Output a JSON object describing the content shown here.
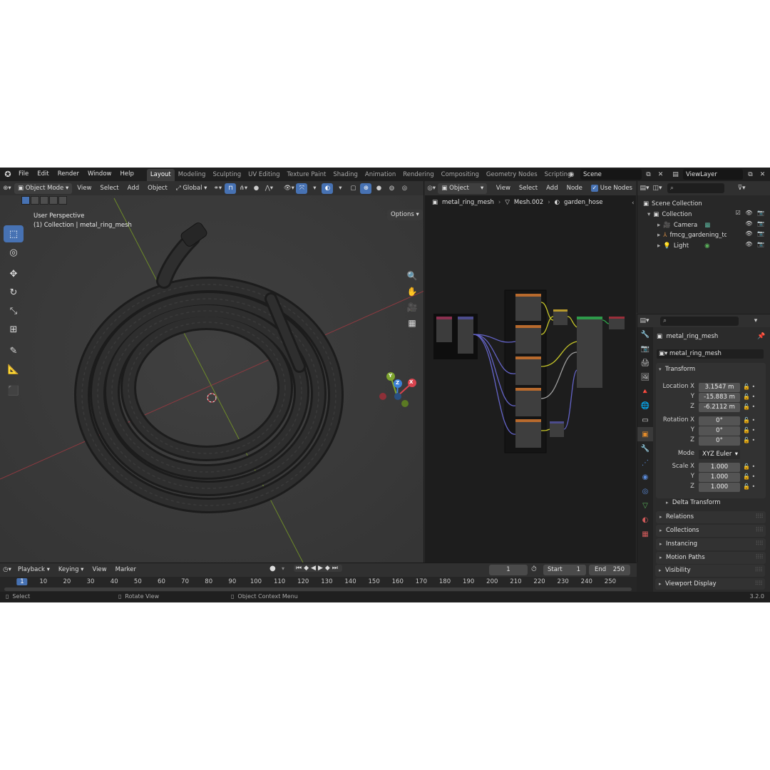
{
  "topbar": {
    "menus": [
      "File",
      "Edit",
      "Render",
      "Window",
      "Help"
    ],
    "workspaces": [
      "Layout",
      "Modeling",
      "Sculpting",
      "UV Editing",
      "Texture Paint",
      "Shading",
      "Animation",
      "Rendering",
      "Compositing",
      "Geometry Nodes",
      "Scripting"
    ],
    "active_workspace": "Layout",
    "scene": "Scene",
    "view_layer": "ViewLayer"
  },
  "viewport": {
    "mode": "Object Mode",
    "menus": [
      "View",
      "Select",
      "Add",
      "Object"
    ],
    "orientation": "Global",
    "options": "Options",
    "overlay_title": "User Perspective",
    "overlay_subtitle": "(1) Collection | metal_ring_mesh",
    "gizmo": {
      "x": "X",
      "y": "Y",
      "z": "Z"
    }
  },
  "node_editor": {
    "type": "Object",
    "menus": [
      "View",
      "Select",
      "Add",
      "Node"
    ],
    "use_nodes": "Use Nodes",
    "breadcrumb": [
      "metal_ring_mesh",
      "Mesh.002",
      "garden_hose"
    ]
  },
  "outliner": {
    "root": "Scene Collection",
    "collection": "Collection",
    "items": [
      "Camera",
      "fmcg_gardening_tool",
      "Light"
    ]
  },
  "properties": {
    "object_name": "metal_ring_mesh",
    "data_name": "metal_ring_mesh",
    "transform_label": "Transform",
    "location": {
      "label": "Location X",
      "x": "3.1547 m",
      "y": "-15.883 m",
      "z": "-6.2112 m"
    },
    "rotation": {
      "label": "Rotation X",
      "x": "0°",
      "y": "0°",
      "z": "0°"
    },
    "mode_label": "Mode",
    "mode_value": "XYZ Euler",
    "scale": {
      "label": "Scale X",
      "x": "1.000",
      "y": "1.000",
      "z": "1.000"
    },
    "axis_y": "Y",
    "axis_z": "Z",
    "delta_transform": "Delta Transform",
    "panels": [
      "Relations",
      "Collections",
      "Instancing",
      "Motion Paths",
      "Visibility",
      "Viewport Display"
    ]
  },
  "timeline": {
    "menus": [
      "Playback",
      "Keying",
      "View",
      "Marker"
    ],
    "current_frame": "1",
    "start_label": "Start",
    "start": "1",
    "end_label": "End",
    "end": "250",
    "ticks": [
      "1",
      "10",
      "20",
      "30",
      "40",
      "50",
      "60",
      "70",
      "80",
      "90",
      "100",
      "110",
      "120",
      "130",
      "140",
      "150",
      "160",
      "170",
      "180",
      "190",
      "200",
      "210",
      "220",
      "230",
      "240",
      "250"
    ]
  },
  "statusbar": {
    "select": "Select",
    "rotate": "Rotate View",
    "context": "Object Context Menu",
    "version": "3.2.0"
  },
  "colors": {
    "accent": "#4772b3",
    "x_axis": "#d9444f",
    "y_axis": "#7ea52f",
    "z_axis": "#3b7fd6"
  }
}
